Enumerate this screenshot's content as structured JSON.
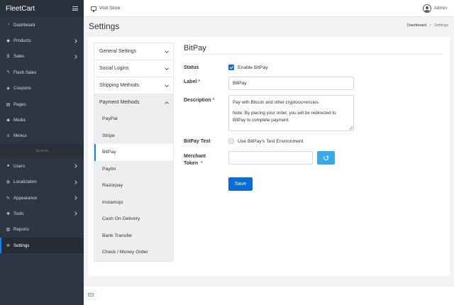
{
  "app": {
    "brand": "FleetCart"
  },
  "topbar": {
    "visit_store": "Visit Store",
    "user": "Admin"
  },
  "sidebar": {
    "items": [
      {
        "label": "Dashboard",
        "icon": "dashboard-icon",
        "glyph": "◔",
        "chevron": false,
        "active": false
      },
      {
        "label": "Products",
        "icon": "cube-icon",
        "glyph": "◆",
        "chevron": true,
        "active": false
      },
      {
        "label": "Sales",
        "icon": "dollar-icon",
        "glyph": "$",
        "chevron": true,
        "active": false
      },
      {
        "label": "Flash Sales",
        "icon": "bolt-icon",
        "glyph": "ϟ",
        "chevron": false,
        "active": false
      },
      {
        "label": "Coupons",
        "icon": "tag-icon",
        "glyph": "◈",
        "chevron": false,
        "active": false
      },
      {
        "label": "Pages",
        "icon": "file-icon",
        "glyph": "▤",
        "chevron": false,
        "active": false
      },
      {
        "label": "Media",
        "icon": "camera-icon",
        "glyph": "◙",
        "chevron": false,
        "active": false
      },
      {
        "label": "Menus",
        "icon": "bars-icon",
        "glyph": "≡",
        "chevron": false,
        "active": false
      }
    ],
    "section_label": "System",
    "system_items": [
      {
        "label": "Users",
        "icon": "users-icon",
        "glyph": "●",
        "chevron": true,
        "active": false
      },
      {
        "label": "Localization",
        "icon": "globe-icon",
        "glyph": "◍",
        "chevron": true,
        "active": false
      },
      {
        "label": "Appearance",
        "icon": "paint-brush-icon",
        "glyph": "✎",
        "chevron": true,
        "active": false
      },
      {
        "label": "Tools",
        "icon": "wrench-icon",
        "glyph": "✚",
        "chevron": true,
        "active": false
      },
      {
        "label": "Reports",
        "icon": "bar-chart-icon",
        "glyph": "▥",
        "chevron": false,
        "active": false
      },
      {
        "label": "Settings",
        "icon": "cogs-icon",
        "glyph": "✲",
        "chevron": false,
        "active": true
      }
    ]
  },
  "page": {
    "title": "Settings",
    "breadcrumb": {
      "home": "Dashboard",
      "sep": ">",
      "current": "Settings"
    }
  },
  "tabs": {
    "general": "General Settings",
    "social": "Social Logins",
    "shipping": "Shipping Methods",
    "payment": "Payment Methods",
    "payment_items": [
      {
        "label": "PayPal",
        "active": false
      },
      {
        "label": "Stripe",
        "active": false
      },
      {
        "label": "BitPay",
        "active": true
      },
      {
        "label": "Paytm",
        "active": false
      },
      {
        "label": "Razorpay",
        "active": false
      },
      {
        "label": "Instamojo",
        "active": false
      },
      {
        "label": "Cash On Delivery",
        "active": false
      },
      {
        "label": "Bank Transfer",
        "active": false
      },
      {
        "label": "Check / Money Order",
        "active": false
      }
    ]
  },
  "form": {
    "title": "BitPay",
    "status_label": "Status",
    "enable_label": "Enable BitPay",
    "enable_checked": true,
    "label_label": "Label",
    "label_value": "BitPay",
    "description_label": "Description",
    "description_line1": "Pay with Bitcoin and other cryptocurrencies.",
    "description_line2": "Note: By placing your order, you will be redirected to",
    "description_line3": "BitPay to complete payment.",
    "test_label": "BitPay Test",
    "test_checkbox_label": "Use BitPay's Test Environment",
    "test_checked": false,
    "token_label_1": "Merchant",
    "token_label_2": "Token",
    "token_value": "",
    "required_mark": "*",
    "save": "Save"
  }
}
